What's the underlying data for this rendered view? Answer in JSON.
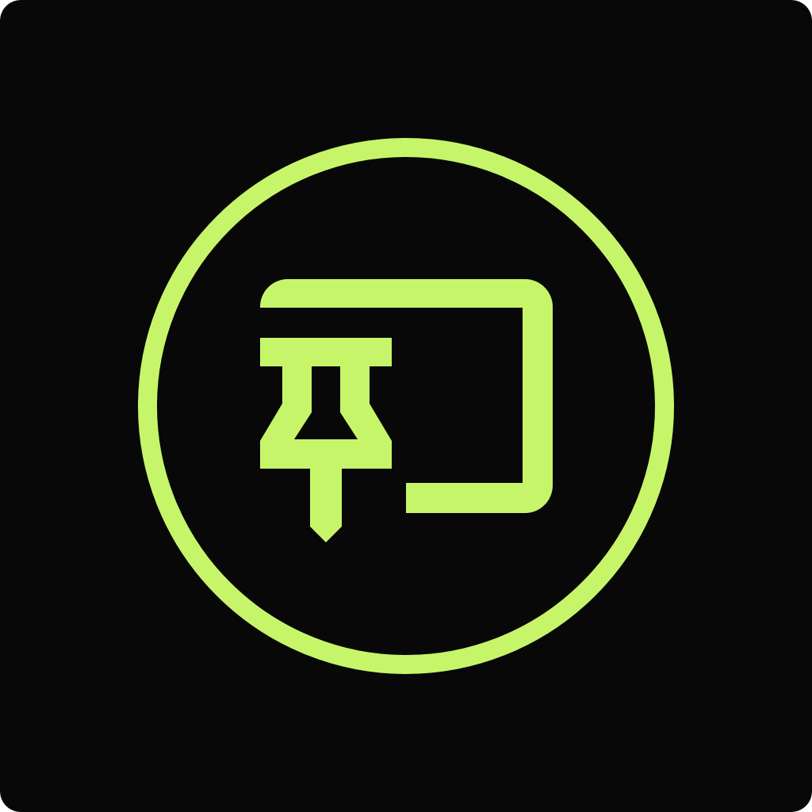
{
  "app_icon": {
    "name": "pin-to-window-app-icon",
    "icon": "pin-window-icon",
    "colors": {
      "background": "#080808",
      "accent": "#C7F56A"
    }
  }
}
